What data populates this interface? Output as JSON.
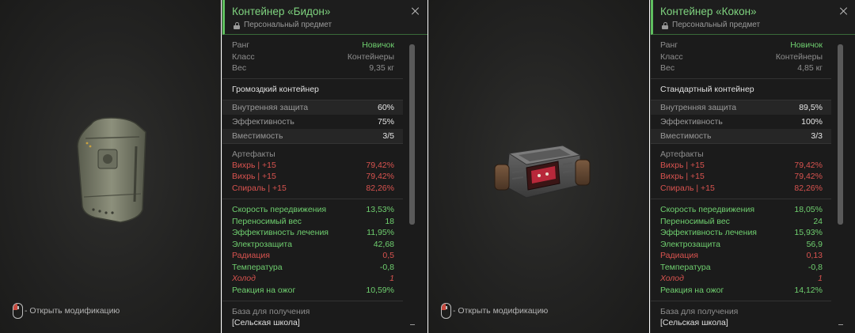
{
  "mod_hint": "- Открыть модификацию",
  "colors": {
    "accent": "#5fbf5f",
    "positive": "#6fcf6f",
    "negative": "#d9534f"
  },
  "cards": [
    {
      "title": "Контейнер «Бидон»",
      "subtitle": "Персональный предмет",
      "base": [
        {
          "label": "Ранг",
          "value": "Новичок"
        },
        {
          "label": "Класс",
          "value": "Контейнеры"
        },
        {
          "label": "Вес",
          "value": "9,35 кг"
        }
      ],
      "type": "Громоздкий контейнер",
      "stats": [
        {
          "label": "Внутренняя защита",
          "value": "60%"
        },
        {
          "label": "Эффективность",
          "value": "75%"
        },
        {
          "label": "Вместимость",
          "value": "3/5"
        }
      ],
      "artifacts_title": "Артефакты",
      "artifacts": [
        {
          "label": "Вихрь | +15",
          "value": "79,42%"
        },
        {
          "label": "Вихрь | +15",
          "value": "79,42%"
        },
        {
          "label": "Спираль | +15",
          "value": "82,26%"
        }
      ],
      "effects": [
        {
          "label": "Скорость передвижения",
          "value": "13,53%"
        },
        {
          "label": "Переносимый вес",
          "value": "18"
        },
        {
          "label": "Эффективность лечения",
          "value": "11,95%"
        },
        {
          "label": "Электрозащита",
          "value": "42,68"
        },
        {
          "label": "Радиация",
          "value": "0,5"
        },
        {
          "label": "Температура",
          "value": "-0,8"
        },
        {
          "label": "Холод",
          "value": "1"
        },
        {
          "label": "Реакция на ожог",
          "value": "10,59%"
        }
      ],
      "source_title": "База для получения",
      "source_value": "[Сельская школа]"
    },
    {
      "title": "Контейнер «Кокон»",
      "subtitle": "Персональный предмет",
      "base": [
        {
          "label": "Ранг",
          "value": "Новичок"
        },
        {
          "label": "Класс",
          "value": "Контейнеры"
        },
        {
          "label": "Вес",
          "value": "4,85 кг"
        }
      ],
      "type": "Стандартный контейнер",
      "stats": [
        {
          "label": "Внутренняя защита",
          "value": "89,5%"
        },
        {
          "label": "Эффективность",
          "value": "100%"
        },
        {
          "label": "Вместимость",
          "value": "3/3"
        }
      ],
      "artifacts_title": "Артефакты",
      "artifacts": [
        {
          "label": "Вихрь | +15",
          "value": "79,42%"
        },
        {
          "label": "Вихрь | +15",
          "value": "79,42%"
        },
        {
          "label": "Спираль | +15",
          "value": "82,26%"
        }
      ],
      "effects": [
        {
          "label": "Скорость передвижения",
          "value": "18,05%"
        },
        {
          "label": "Переносимый вес",
          "value": "24"
        },
        {
          "label": "Эффективность лечения",
          "value": "15,93%"
        },
        {
          "label": "Электрозащита",
          "value": "56,9"
        },
        {
          "label": "Радиация",
          "value": "0,13"
        },
        {
          "label": "Температура",
          "value": "-0,8"
        },
        {
          "label": "Холод",
          "value": "1"
        },
        {
          "label": "Реакция на ожог",
          "value": "14,12%"
        }
      ],
      "source_title": "База для получения",
      "source_value": "[Сельская школа]"
    }
  ]
}
